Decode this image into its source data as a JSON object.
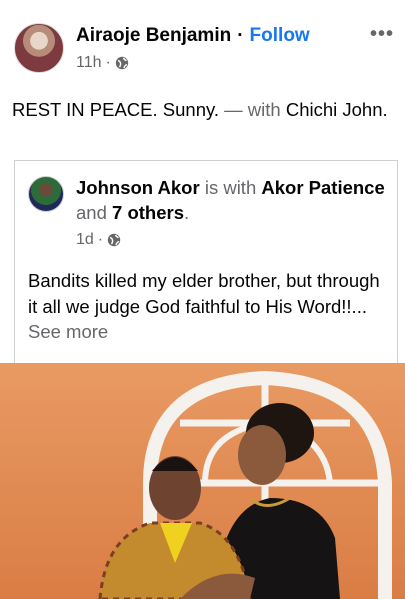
{
  "post": {
    "author": "Airaoje Benjamin",
    "separator": "·",
    "follow_label": "Follow",
    "time": "11h",
    "time_separator": "·",
    "more_label": "•••",
    "text": "REST IN PEACE. Sunny.",
    "with_text": " — with ",
    "with_name": "Chichi John."
  },
  "shared": {
    "author": "Johnson Akor",
    "is_with": " is with ",
    "tagged": "Akor Patience",
    "and": " and ",
    "others": "7 others",
    "period": ".",
    "time": "1d",
    "time_separator": "·",
    "text": "Bandits killed my elder brother, but through it all we judge  God faithful to His Word!!...",
    "see_more": " See more"
  },
  "icons": {
    "privacy": "globe-icon",
    "menu": "more-options-icon"
  },
  "colors": {
    "link_blue": "#1877f2",
    "secondary_text": "#65676b",
    "photo_background": "#e68a52"
  }
}
